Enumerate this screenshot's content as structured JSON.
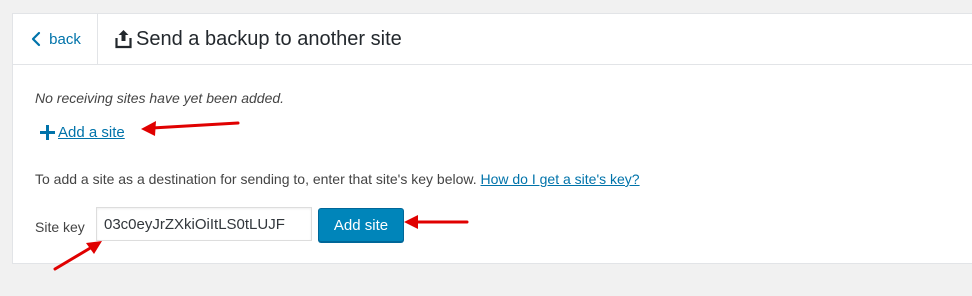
{
  "header": {
    "back_label": "back",
    "title": "Send a backup to another site"
  },
  "content": {
    "notice": "No receiving sites have yet been added.",
    "add_link_label": "Add a site",
    "instructions": "To add a site as a destination for sending to, enter that site's key below.",
    "help_link_label": "How do I get a site's key?"
  },
  "form": {
    "key_label": "Site key",
    "key_value": "03c0eyJrZXkiOiItLS0tLUJF",
    "submit_label": "Add site"
  },
  "colors": {
    "link": "#0073aa",
    "button": "#0085ba",
    "annotation_arrow": "#e00000"
  },
  "icons": {
    "back": "chevron-left-icon",
    "title": "upload-icon",
    "add": "plus-icon"
  }
}
